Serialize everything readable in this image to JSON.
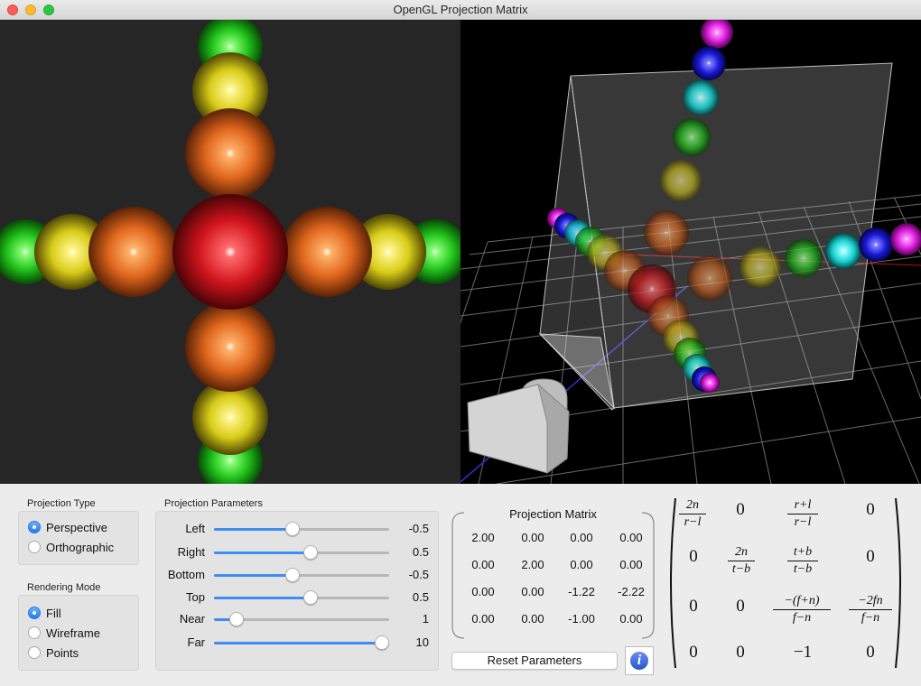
{
  "window": {
    "title": "OpenGL Projection Matrix"
  },
  "projection_type": {
    "label": "Projection Type",
    "options": [
      {
        "label": "Perspective",
        "selected": true
      },
      {
        "label": "Orthographic",
        "selected": false
      }
    ]
  },
  "rendering_mode": {
    "label": "Rendering Mode",
    "options": [
      {
        "label": "Fill",
        "selected": true
      },
      {
        "label": "Wireframe",
        "selected": false
      },
      {
        "label": "Points",
        "selected": false
      }
    ]
  },
  "parameters": {
    "label": "Projection Parameters",
    "items": [
      {
        "label": "Left",
        "value": "-0.5",
        "fraction": 0.45
      },
      {
        "label": "Right",
        "value": "0.5",
        "fraction": 0.55
      },
      {
        "label": "Bottom",
        "value": "-0.5",
        "fraction": 0.45
      },
      {
        "label": "Top",
        "value": "0.5",
        "fraction": 0.55
      },
      {
        "label": "Near",
        "value": "1",
        "fraction": 0.13
      },
      {
        "label": "Far",
        "value": "10",
        "fraction": 0.96
      }
    ]
  },
  "matrix": {
    "title": "Projection Matrix",
    "rows": [
      [
        "2.00",
        "0.00",
        "0.00",
        "0.00"
      ],
      [
        "0.00",
        "2.00",
        "0.00",
        "0.00"
      ],
      [
        "0.00",
        "0.00",
        "-1.22",
        "-2.22"
      ],
      [
        "0.00",
        "0.00",
        "-1.00",
        "0.00"
      ]
    ]
  },
  "buttons": {
    "reset": "Reset Parameters",
    "info": "i"
  },
  "formula": {
    "r00": {
      "num": "2n",
      "den": "r−l"
    },
    "r02": {
      "num": "r+l",
      "den": "r−l"
    },
    "r11": {
      "num": "2n",
      "den": "t−b"
    },
    "r12": {
      "num": "t+b",
      "den": "t−b"
    },
    "r22": {
      "num": "−(f+n)",
      "den": "f−n"
    },
    "r23": {
      "num": "−2fn",
      "den": "f−n"
    },
    "zero": "0",
    "minus_one": "−1"
  },
  "colors": {
    "accent": "#3d8ef0",
    "red": "#d0141c",
    "orange": "#e0661c",
    "yellow": "#e4d41c",
    "green": "#22c41c",
    "cyan": "#1ce4e4",
    "blue": "#1c1ce4",
    "magenta": "#e41ce4"
  },
  "icons": {
    "info": "info-icon"
  }
}
